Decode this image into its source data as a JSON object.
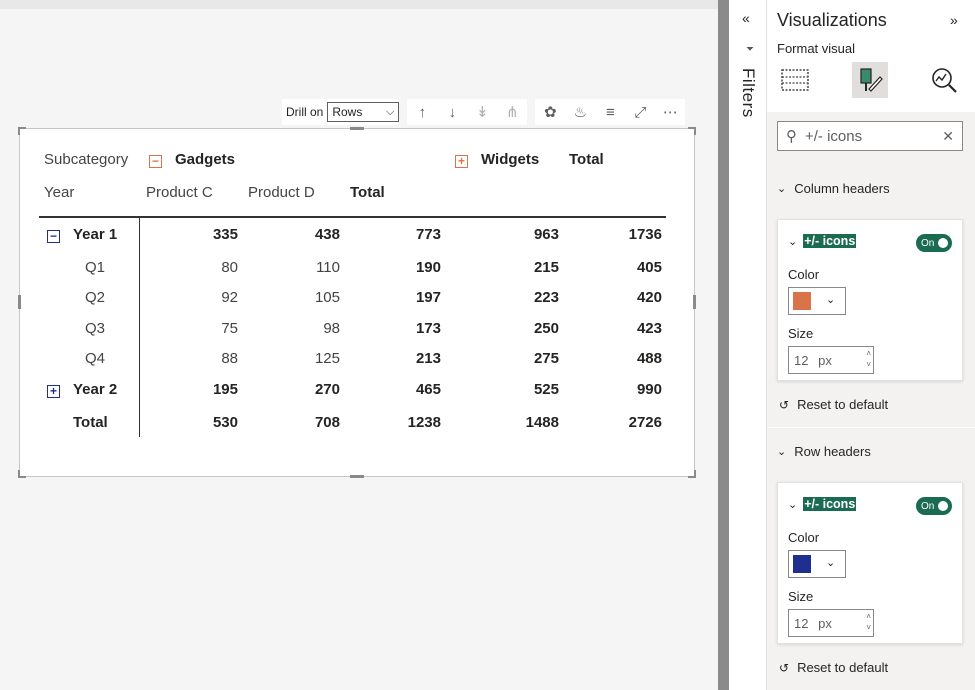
{
  "toolbar": {
    "drill_on_label": "Drill on",
    "drill_on_value": "Rows"
  },
  "matrix": {
    "header_row1": {
      "label": "Subcategory",
      "group1": "Gadgets",
      "group2": "Widgets",
      "total": "Total"
    },
    "header_row2": {
      "label": "Year",
      "col1": "Product C",
      "col2": "Product D",
      "total": "Total"
    },
    "rows": [
      {
        "label": "Year 1",
        "c": "335",
        "d": "438",
        "gt": "773",
        "w": "963",
        "t": "1736"
      },
      {
        "label": "Q1",
        "c": "80",
        "d": "110",
        "gt": "190",
        "w": "215",
        "t": "405"
      },
      {
        "label": "Q2",
        "c": "92",
        "d": "105",
        "gt": "197",
        "w": "223",
        "t": "420"
      },
      {
        "label": "Q3",
        "c": "75",
        "d": "98",
        "gt": "173",
        "w": "250",
        "t": "423"
      },
      {
        "label": "Q4",
        "c": "88",
        "d": "125",
        "gt": "213",
        "w": "275",
        "t": "488"
      },
      {
        "label": "Year 2",
        "c": "195",
        "d": "270",
        "gt": "465",
        "w": "525",
        "t": "990"
      },
      {
        "label": "Total",
        "c": "530",
        "d": "708",
        "gt": "1238",
        "w": "1488",
        "t": "2726"
      }
    ],
    "col_icon_color": "#d9734a",
    "row_icon_color": "#1e2f8f"
  },
  "filters": {
    "label": "Filters"
  },
  "visualizations": {
    "title": "Visualizations",
    "subtitle": "Format visual",
    "search_value": "+/- icons",
    "column_headers": {
      "section": "Column headers",
      "card_title": "+/- icons",
      "toggle": "On",
      "color_label": "Color",
      "color": "#d9734a",
      "size_label": "Size",
      "size_value": "12",
      "size_unit": "px",
      "reset": "Reset to default"
    },
    "row_headers": {
      "section": "Row headers",
      "card_title": "+/- icons",
      "toggle": "On",
      "color_label": "Color",
      "color": "#1e2f8f",
      "size_label": "Size",
      "size_value": "12",
      "size_unit": "px",
      "reset": "Reset to default"
    }
  }
}
